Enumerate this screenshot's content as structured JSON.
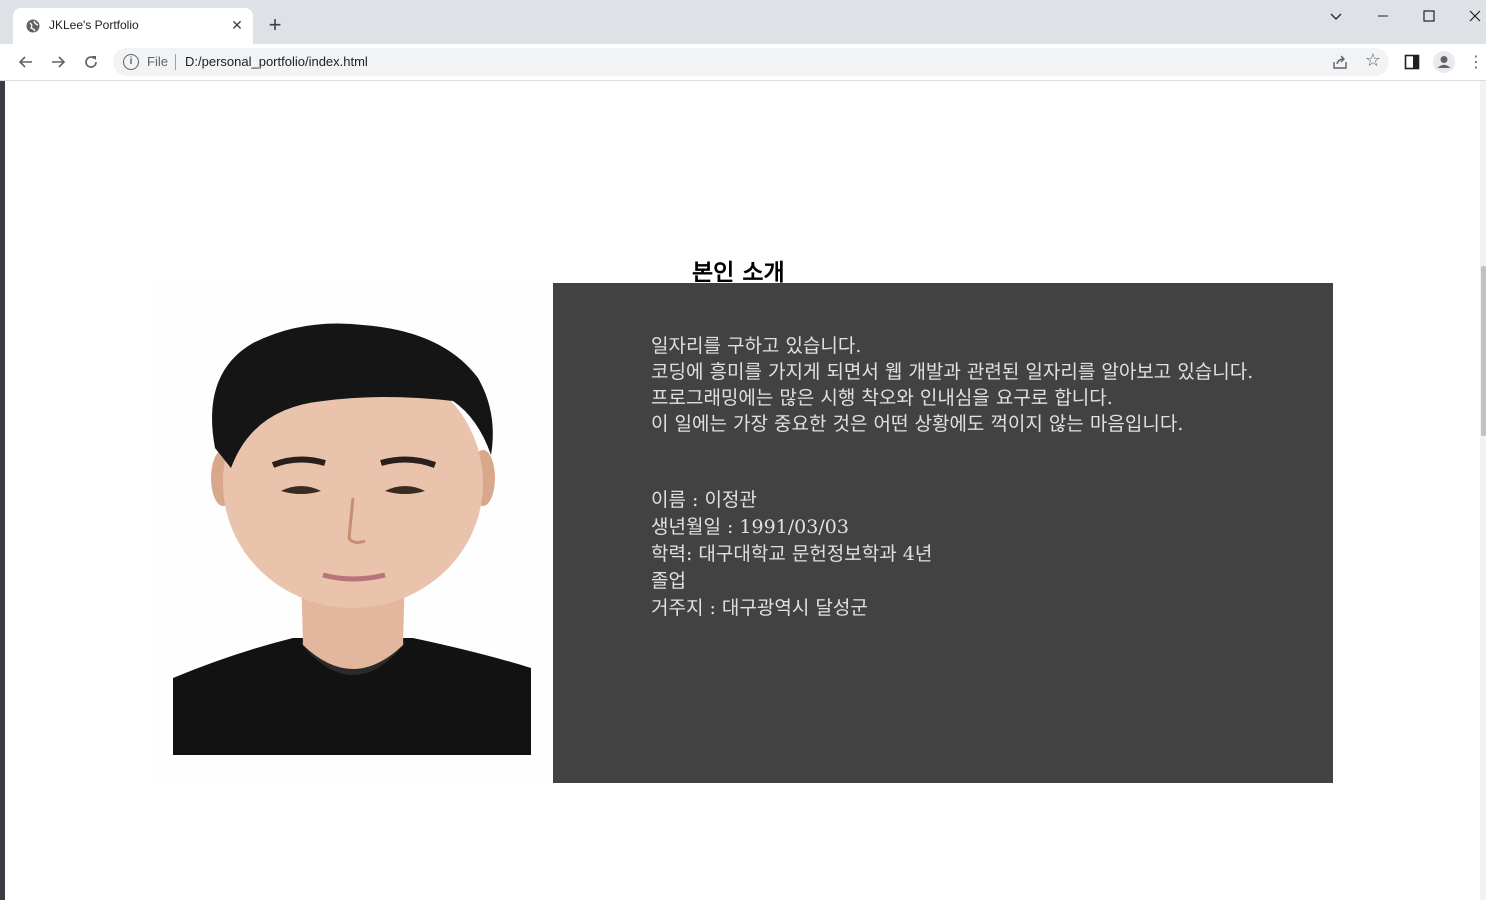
{
  "browser": {
    "tab_title": "JKLee's Portfolio",
    "scheme_label": "File",
    "url": "D:/personal_portfolio/index.html",
    "icons": [
      "globe-icon",
      "close-icon",
      "plus-icon",
      "back-icon",
      "forward-icon",
      "reload-icon",
      "info-icon",
      "share-icon",
      "star-icon",
      "sidebar-icon",
      "profile-icon",
      "more-icon",
      "chevron-down-icon",
      "minimize-icon",
      "maximize-icon",
      "window-close-icon"
    ]
  },
  "page": {
    "section_title": "본인 소개",
    "intro_lines": [
      "일자리를 구하고 있습니다.",
      "코딩에 흥미를 가지게 되면서 웹 개발과 관련된 일자리를 알아보고 있습니다.",
      "프로그래밍에는 많은 시행 착오와 인내심을 요구로 합니다.",
      "이 일에는 가장 중요한 것은 어떤 상황에도 꺽이지 않는 마음입니다."
    ],
    "details": {
      "name": "이름 : 이정관",
      "birth": "생년월일 : 1991/03/03",
      "education": "학력: 대구대학교 문헌정보학과 4년",
      "education_cont": "졸업",
      "residence": "거주지 : 대구광역시 달성군"
    },
    "colors": {
      "info_box_bg": "#424242",
      "info_text": "#e0e0e0"
    }
  }
}
